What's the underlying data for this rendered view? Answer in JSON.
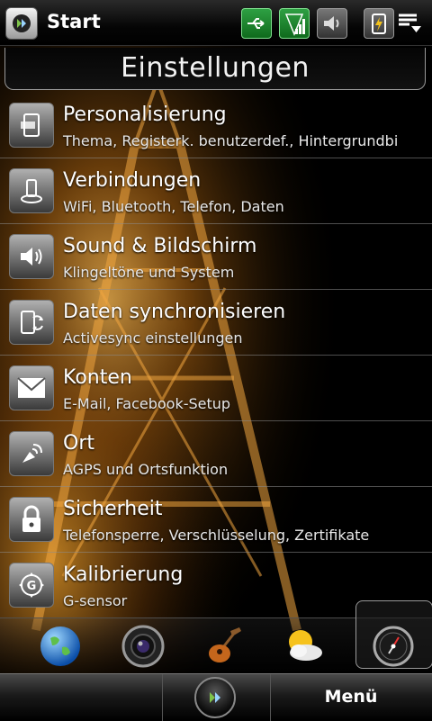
{
  "statusbar": {
    "start_label": "Start",
    "icons": [
      "usb-connection-icon",
      "signal-strength-icon",
      "volume-icon",
      "battery-charging-icon",
      "menu-toggle-icon"
    ]
  },
  "header": {
    "title": "Einstellungen"
  },
  "settings": {
    "items": [
      {
        "title": "Personalisierung",
        "subtitle": "Thema, Registerk. benutzerdef., Hintergrundbi",
        "icon": "personalize-icon"
      },
      {
        "title": "Verbindungen",
        "subtitle": "WiFi, Bluetooth, Telefon, Daten",
        "icon": "connections-icon"
      },
      {
        "title": "Sound & Bildschirm",
        "subtitle": "Klingeltöne und System",
        "icon": "sound-icon"
      },
      {
        "title": "Daten synchronisieren",
        "subtitle": "Activesync einstellungen",
        "icon": "sync-icon"
      },
      {
        "title": "Konten",
        "subtitle": "E-Mail, Facebook-Setup",
        "icon": "mail-icon"
      },
      {
        "title": "Ort",
        "subtitle": "AGPS und Ortsfunktion",
        "icon": "location-antenna-icon"
      },
      {
        "title": "Sicherheit",
        "subtitle": "Telefonsperre, Verschlüsselung, Zertifikate",
        "icon": "lock-icon"
      },
      {
        "title": "Kalibrierung",
        "subtitle": "G-sensor",
        "icon": "gsensor-icon"
      }
    ]
  },
  "dock": {
    "items": [
      "internet-globe-icon",
      "camera-icon",
      "music-guitar-icon",
      "weather-icon",
      "settings-compass-icon"
    ]
  },
  "softkeys": {
    "right_label": "Menü"
  },
  "colors": {
    "accent_green": "#2ea043",
    "background": "#000000",
    "separator": "#8c8c8c"
  }
}
